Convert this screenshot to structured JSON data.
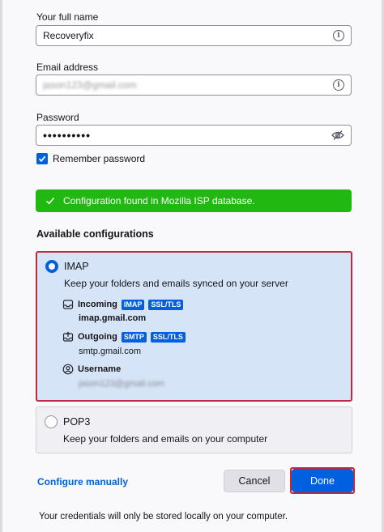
{
  "form": {
    "fullname_label": "Your full name",
    "fullname_value": "Recoveryfix",
    "email_label": "Email address",
    "email_value": "jason123@gmail.com",
    "password_label": "Password",
    "password_value": "••••••••••",
    "remember_label": "Remember password",
    "remember_checked": true
  },
  "banner": {
    "text": "Configuration found in Mozilla ISP database.",
    "icon": "checkmark-icon"
  },
  "available_title": "Available configurations",
  "imap": {
    "title": "IMAP",
    "description": "Keep your folders and emails synced on your server",
    "incoming_label": "Incoming",
    "incoming_badge_protocol": "IMAP",
    "incoming_badge_security": "SSL/TLS",
    "incoming_host": "imap.gmail.com",
    "outgoing_label": "Outgoing",
    "outgoing_badge_protocol": "SMTP",
    "outgoing_badge_security": "SSL/TLS",
    "outgoing_host": "smtp.gmail.com",
    "username_label": "Username",
    "username_value": "jason123@gmail.com",
    "selected": true
  },
  "pop3": {
    "title": "POP3",
    "description": "Keep your folders and emails on your computer",
    "selected": false
  },
  "actions": {
    "configure_manually": "Configure manually",
    "cancel": "Cancel",
    "done": "Done"
  },
  "footer_note": "Your credentials will only be stored locally on your computer.",
  "colors": {
    "accent": "#0060df",
    "success": "#21b811",
    "highlight_border": "#c0293c",
    "selected_card_bg": "#d5e5f7"
  }
}
